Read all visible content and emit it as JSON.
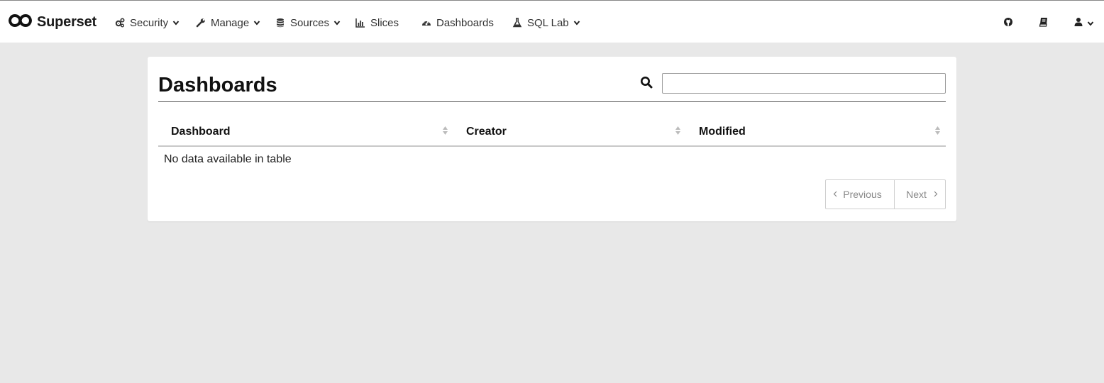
{
  "navbar": {
    "brand": {
      "name": "Superset",
      "icon": "infinity-logo-icon"
    },
    "items": [
      {
        "label": "Security",
        "icon": "cogs-icon",
        "has_dropdown": true
      },
      {
        "label": "Manage",
        "icon": "wrench-icon",
        "has_dropdown": true
      },
      {
        "label": "Sources",
        "icon": "database-icon",
        "has_dropdown": true
      },
      {
        "label": "Slices",
        "icon": "bar-chart-icon",
        "has_dropdown": false
      },
      {
        "label": "Dashboards",
        "icon": "dashboard-gauge-icon",
        "has_dropdown": false
      },
      {
        "label": "SQL Lab",
        "icon": "flask-icon",
        "has_dropdown": true
      }
    ],
    "right_items": [
      {
        "icon": "github-icon"
      },
      {
        "icon": "book-icon"
      },
      {
        "icon": "user-icon",
        "has_dropdown": true
      }
    ]
  },
  "page": {
    "title": "Dashboards",
    "search": {
      "value": "",
      "placeholder": "",
      "icon": "search-icon"
    }
  },
  "table": {
    "columns": [
      "Dashboard",
      "Creator",
      "Modified"
    ],
    "rows": [],
    "empty_message": "No data available in table"
  },
  "pagination": {
    "previous_label": "Previous",
    "next_label": "Next"
  },
  "colors": {
    "background": "#e8e8e8",
    "panel": "#ffffff",
    "text": "#222222",
    "muted": "#888888"
  }
}
